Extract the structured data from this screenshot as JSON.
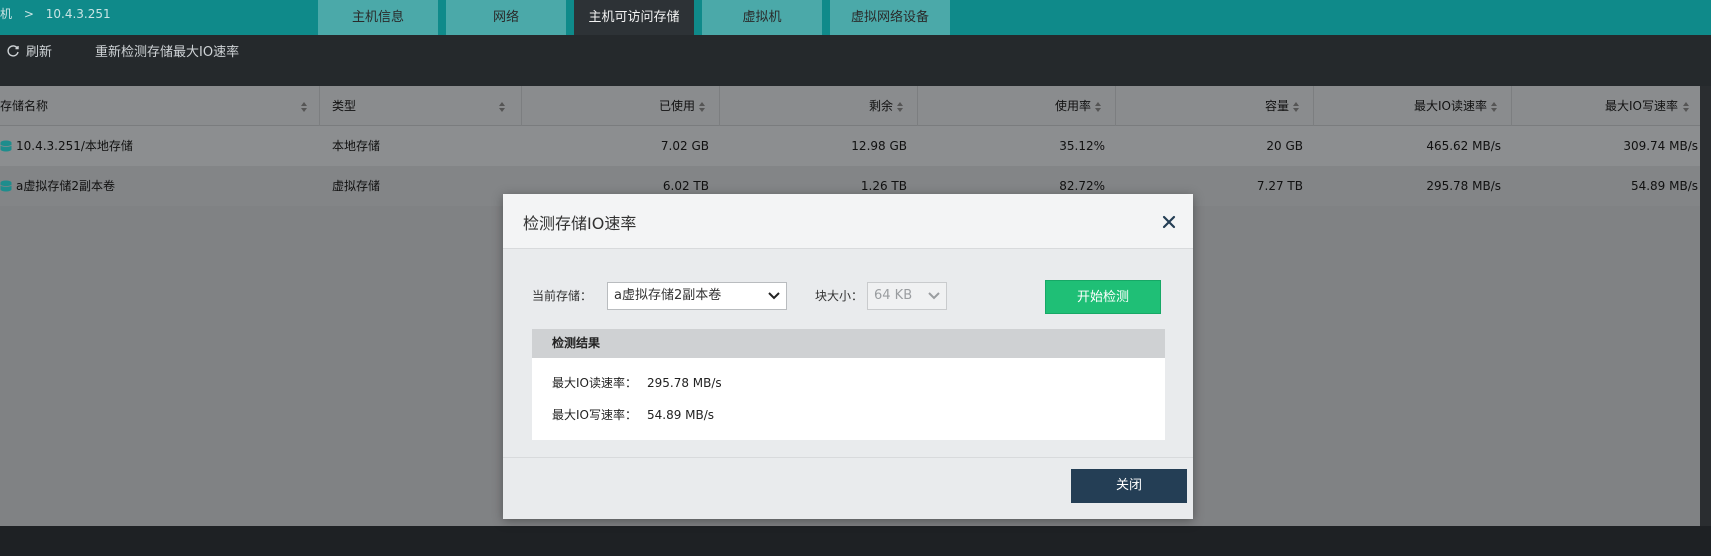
{
  "breadcrumb": {
    "part1": "机",
    "sep": ">",
    "host": "10.4.3.251"
  },
  "tabs": [
    {
      "label": "主机信息"
    },
    {
      "label": "网络"
    },
    {
      "label": "主机可访问存储"
    },
    {
      "label": "虚拟机"
    },
    {
      "label": "虚拟网络设备"
    }
  ],
  "toolbar": {
    "refresh_label": "刷新",
    "redetect_label": "重新检测存储最大IO速率"
  },
  "table": {
    "columns": [
      "存储名称",
      "类型",
      "已使用",
      "剩余",
      "使用率",
      "容量",
      "最大IO读速率",
      "最大IO写速率"
    ],
    "rows": [
      {
        "name": "10.4.3.251/本地存储",
        "type": "本地存储",
        "used": "7.02 GB",
        "remaining": "12.98 GB",
        "usage": "35.12%",
        "capacity": "20 GB",
        "read": "465.62 MB/s",
        "write": "309.74 MB/s"
      },
      {
        "name": "a虚拟存储2副本卷",
        "type": "虚拟存储",
        "used": "6.02 TB",
        "remaining": "1.26 TB",
        "usage": "82.72%",
        "capacity": "7.27 TB",
        "read": "295.78 MB/s",
        "write": "54.89 MB/s"
      }
    ]
  },
  "modal": {
    "title": "检测存储IO速率",
    "current_storage_label": "当前存储：",
    "current_storage_value": "a虚拟存储2副本卷",
    "block_size_label": "块大小：",
    "block_size_value": "64 KB",
    "start_button": "开始检测",
    "result_title": "检测结果",
    "read_label": "最大IO读速率：",
    "read_value": "295.78 MB/s",
    "write_label": "最大IO写速率：",
    "write_value": "54.89 MB/s",
    "close_button": "关闭"
  },
  "colors": {
    "teal": "#0f8a8a",
    "green_button": "#1fbf76",
    "dark_button": "#243e55"
  }
}
